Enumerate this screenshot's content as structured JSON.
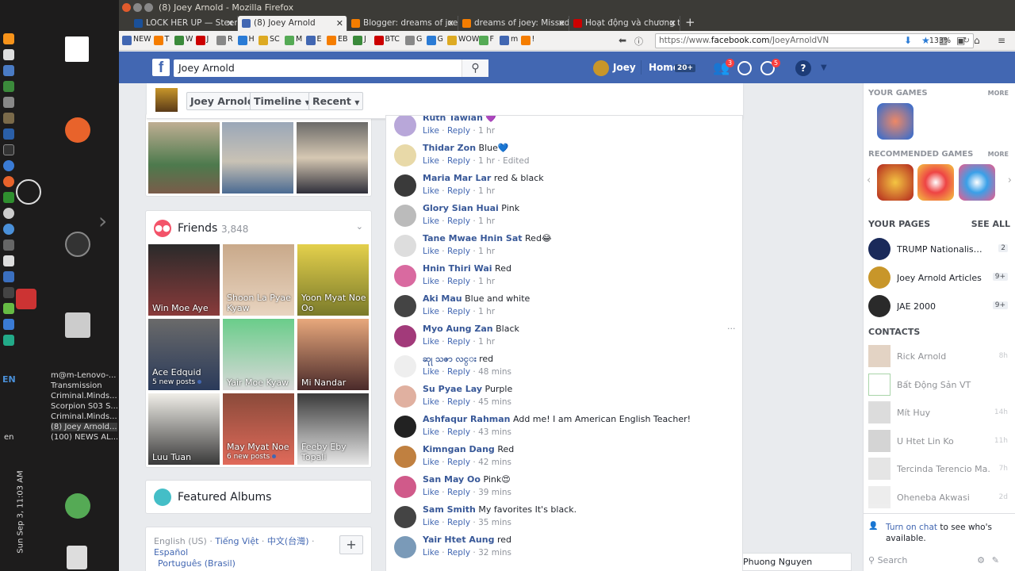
{
  "window": {
    "title": "(8) Joey Arnold - Mozilla Firefox"
  },
  "tabs": [
    {
      "label": "LOCK HER UP — Steem",
      "icon_color": "#1a5099"
    },
    {
      "label": "(8) Joey Arnold",
      "icon_color": "#4267b2"
    },
    {
      "label": "Blogger: dreams of joe",
      "icon_color": "#f57d00"
    },
    {
      "label": "dreams of joey: Missed",
      "icon_color": "#f57d00"
    },
    {
      "label": "Hoạt động và chương tr",
      "icon_color": "#cc0000"
    }
  ],
  "new_tab": "+",
  "bookmarks": [
    "NEW",
    "T",
    "W",
    "J",
    "R",
    "H",
    "SC",
    "M",
    "E",
    "EB",
    "J",
    "BTC",
    "G",
    "G",
    "WOW",
    "F",
    "m",
    "!"
  ],
  "url": {
    "prefix": "https://www.",
    "domain": "facebook.com",
    "path": "/JoeyArnoldVN"
  },
  "zoom": "133%",
  "dock": {
    "tray_items": [
      "m@m-Lenovo-...",
      "Transmission",
      "Criminal.Minds...",
      "Scorpion S03 S...",
      "Criminal.Minds...",
      "(8) Joey Arnold...",
      "(100) NEWS AL..."
    ],
    "lang": "EN",
    "lang2": "en",
    "clock": "Sun Sep 3, 11:03 AM"
  },
  "fb": {
    "search_value": "Joey Arnold",
    "user_name": "Joey",
    "home_label": "Home",
    "home_count": "20+",
    "friend_badge": "3",
    "notif_badge": "5",
    "brand": "#4267b2"
  },
  "profile_header": {
    "name_btn": "Joey Arnold",
    "timeline_btn": "Timeline",
    "recent_btn": "Recent"
  },
  "friends": {
    "title": "Friends",
    "count": "3,848",
    "list": [
      {
        "name": "Win Moe Aye",
        "sub": ""
      },
      {
        "name": "Shoon La Pyae Kyaw",
        "sub": ""
      },
      {
        "name": "Yoon Myat Noe Oo",
        "sub": ""
      },
      {
        "name": "Ace Edquid",
        "sub": "5 new posts"
      },
      {
        "name": "Yair Moe Kyaw",
        "sub": ""
      },
      {
        "name": "Mi Nandar",
        "sub": ""
      },
      {
        "name": "Luu Tuan",
        "sub": ""
      },
      {
        "name": "May Myat Noe",
        "sub": "6 new posts"
      },
      {
        "name": "Feeby Eby Topali",
        "sub": ""
      }
    ]
  },
  "featured_albums": "Featured Albums",
  "languages": {
    "line1": [
      "English (US)",
      "Tiếng Việt",
      "中文(台灣)",
      "Español"
    ],
    "line2": "Português (Brasil)",
    "add": "+"
  },
  "comment_actions": {
    "like": "Like",
    "reply": "Reply"
  },
  "comments": [
    {
      "name": "Ruth Tawian",
      "text": "💜",
      "time": "1 hr",
      "edited": ""
    },
    {
      "name": "Thidar Zon",
      "text": "Blue💙",
      "time": "1 hr",
      "edited": "Edited"
    },
    {
      "name": "Maria Mar Lar",
      "text": "red & black",
      "time": "1 hr",
      "edited": ""
    },
    {
      "name": "Glory Sian Huai",
      "text": "Pink",
      "time": "1 hr",
      "edited": ""
    },
    {
      "name": "Tane Mwae Hnin Sat",
      "text": "Red😂",
      "time": "1 hr",
      "edited": ""
    },
    {
      "name": "Hnin Thiri Wai",
      "text": "Red",
      "time": "1 hr",
      "edited": ""
    },
    {
      "name": "Aki Mau",
      "text": "Blue and white",
      "time": "1 hr",
      "edited": ""
    },
    {
      "name": "Myo Aung Zan",
      "text": "Black",
      "time": "1 hr",
      "edited": ""
    },
    {
      "name": "ဆုု သဇာ လင္း",
      "text": "red",
      "time": "48 mins",
      "edited": ""
    },
    {
      "name": "Su Pyae Lay",
      "text": "Purple",
      "time": "45 mins",
      "edited": ""
    },
    {
      "name": "Ashfaqur Rahman",
      "text": "Add me! I am American English Teacher!",
      "time": "43 mins",
      "edited": ""
    },
    {
      "name": "Kimngan Dang",
      "text": "Red",
      "time": "42 mins",
      "edited": ""
    },
    {
      "name": "San May Oo",
      "text": "Pink😍",
      "time": "39 mins",
      "edited": ""
    },
    {
      "name": "Sam Smith",
      "text": "My favorites It's black.",
      "time": "35 mins",
      "edited": ""
    },
    {
      "name": "Yair Htet Aung",
      "text": "red",
      "time": "32 mins",
      "edited": ""
    }
  ],
  "more_dots": "···",
  "right": {
    "your_games": "YOUR GAMES",
    "more": "MORE",
    "recommended": "RECOMMENDED GAMES",
    "more2": "MORE",
    "your_pages": "YOUR PAGES",
    "see_all": "SEE ALL",
    "pages": [
      {
        "name": "TRUMP Nationalism ...",
        "count": "2"
      },
      {
        "name": "Joey Arnold Articles",
        "count": "9+"
      },
      {
        "name": "JAE 2000",
        "count": "9+"
      }
    ],
    "contacts_title": "CONTACTS",
    "contacts": [
      {
        "name": "Rick Arnold",
        "time": "8h"
      },
      {
        "name": "Bất Động Sản VT",
        "time": ""
      },
      {
        "name": "Mít Huy",
        "time": "14h"
      },
      {
        "name": "U Htet Lin Ko",
        "time": "11h"
      },
      {
        "name": "Tercinda Terencio Ma...",
        "time": "7h"
      },
      {
        "name": "Oheneba Akwasi",
        "time": "2d"
      }
    ],
    "chat_link": "Turn on chat",
    "chat_text": " to see who's available.",
    "search_placeholder": "Search"
  },
  "chat_tab": "Phuong Nguyen"
}
